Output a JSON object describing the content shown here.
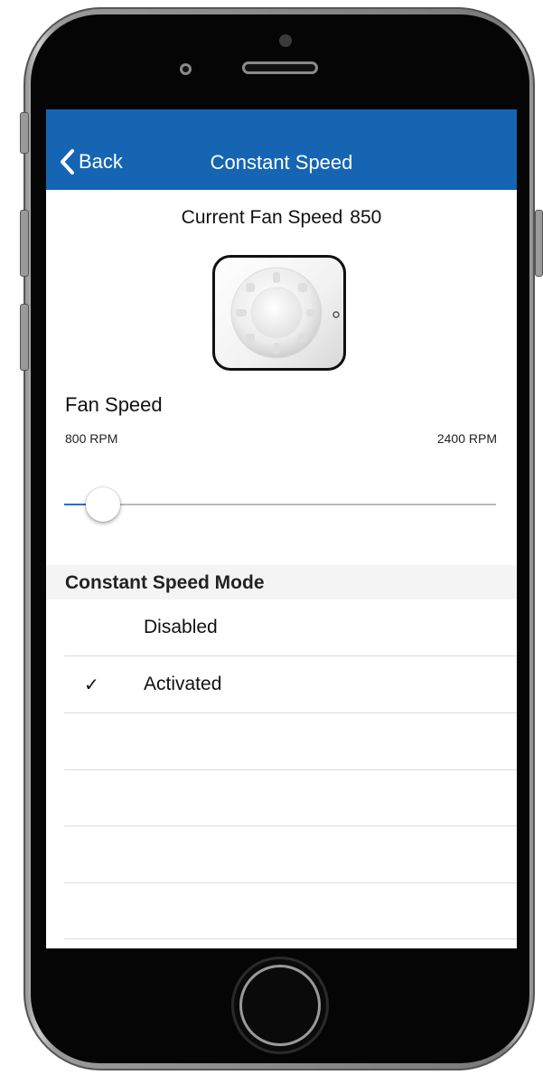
{
  "nav": {
    "back_label": "Back",
    "title": "Constant Speed"
  },
  "status": {
    "current_label": "Current Fan Speed",
    "current_value": "850"
  },
  "fan_speed": {
    "label": "Fan Speed",
    "min_label": "800 RPM",
    "max_label": "2400 RPM",
    "min": 800,
    "max": 2400,
    "value": 850
  },
  "mode": {
    "header": "Constant Speed Mode",
    "options": [
      {
        "label": "Disabled",
        "checked": false
      },
      {
        "label": "Activated",
        "checked": true
      }
    ],
    "check_glyph": "✓"
  },
  "colors": {
    "nav_bar": "#1565b3",
    "slider_fill": "#1a6fd6"
  },
  "icons": {
    "back": "chevron-left-icon",
    "check": "checkmark-icon",
    "fan": "fan-icon"
  }
}
